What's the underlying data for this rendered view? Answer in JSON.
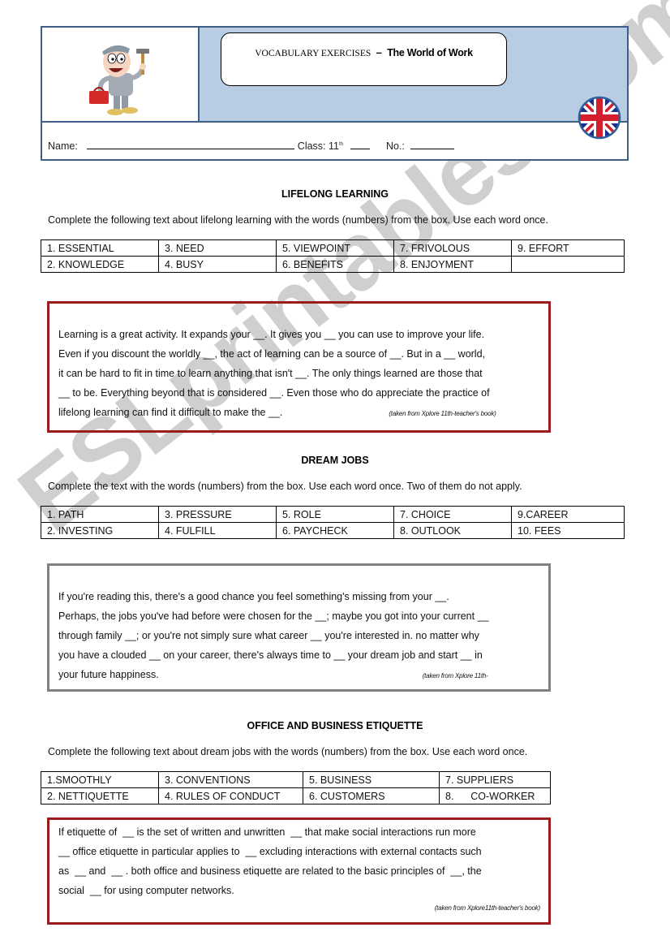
{
  "header": {
    "title_prefix": "VOCABULARY EXERCISES",
    "title_dash": "–",
    "title_main": "The World of Work",
    "name_label": "Name:",
    "class_label": "Class: 11",
    "class_sup": "th",
    "no_label": "No.:",
    "illustration": "worker-with-hammer-and-toolbox",
    "flag": "uk-flag-icon"
  },
  "sections": [
    {
      "title": "LIFELONG LEARNING",
      "instruction": "Complete the following text about lifelong learning with the words (numbers) from the box. Use each word once.",
      "words": [
        [
          "1. ESSENTIAL",
          "3. NEED",
          "5. VIEWPOINT",
          "7. FRIVOLOUS",
          "9. EFFORT"
        ],
        [
          "2. KNOWLEDGE",
          "4. BUSY",
          "6. BENEFITS",
          "8. ENJOYMENT",
          ""
        ]
      ],
      "lines": [
        "Learning is a great activity. It expands your __. It gives you __ you can use to improve your life.",
        "Even if you discount the worldly __, the act of learning can be a source of __. But in a __ world,",
        "it can be hard to fit in time to learn anything that isn't __. The only things learned are those that",
        "__ to be. Everything beyond that is considered __. Even those who do appreciate the practice of",
        "lifelong learning can find it difficult to make the __."
      ],
      "citation": "(taken from Xplore 11th-teacher's book)",
      "border_color": "#9b1b1f"
    },
    {
      "title": "DREAM JOBS",
      "instruction": "Complete the text with the words (numbers) from the box. Use each word once. Two of them do not apply.",
      "words": [
        [
          "1. PATH",
          "3. PRESSURE",
          "5. ROLE",
          "7. CHOICE",
          "9.CAREER"
        ],
        [
          "2. INVESTING",
          "4. FULFILL",
          "6. PAYCHECK",
          "8. OUTLOOK",
          "10. FEES"
        ]
      ],
      "lines": [
        "If you're reading this, there's a good chance you feel something's missing from your __.",
        "Perhaps, the jobs you've had before were chosen for the __; maybe you got into your current __",
        "through family __; or you're not simply sure what career __ you're interested in. no matter why",
        "you have a clouded __ on your career, there's always time to __ your dream job and start __ in",
        "your future happiness."
      ],
      "citation": "(taken from Xplore 11th-",
      "border_color": "#7f7f7f"
    },
    {
      "title": "OFFICE AND BUSINESS ETIQUETTE",
      "instruction": "Complete the following text about dream jobs with the words (numbers) from the box. Use each word once.",
      "words": [
        [
          "1.SMOOTHLY",
          "3. CONVENTIONS",
          "5. BUSINESS",
          "7. SUPPLIERS"
        ],
        [
          "2. NETTIQUETTE",
          "4. RULES OF CONDUCT",
          "6. CUSTOMERS",
          "8.      CO-WORKER"
        ]
      ],
      "lines": [
        "If etiquette of  __ is the set of written and unwritten  __ that make social interactions run more",
        "__ office etiquette in particular applies to  __ excluding interactions with external contacts such",
        "as  __ and  __ . both office and business etiquette are related to the basic principles of  __, the",
        "social  __ for using computer networks."
      ],
      "citation": "(taken from Xplore11th-teacher's book)",
      "border_color": "#9b1b1f"
    }
  ],
  "watermark": "ESLprintables.com"
}
